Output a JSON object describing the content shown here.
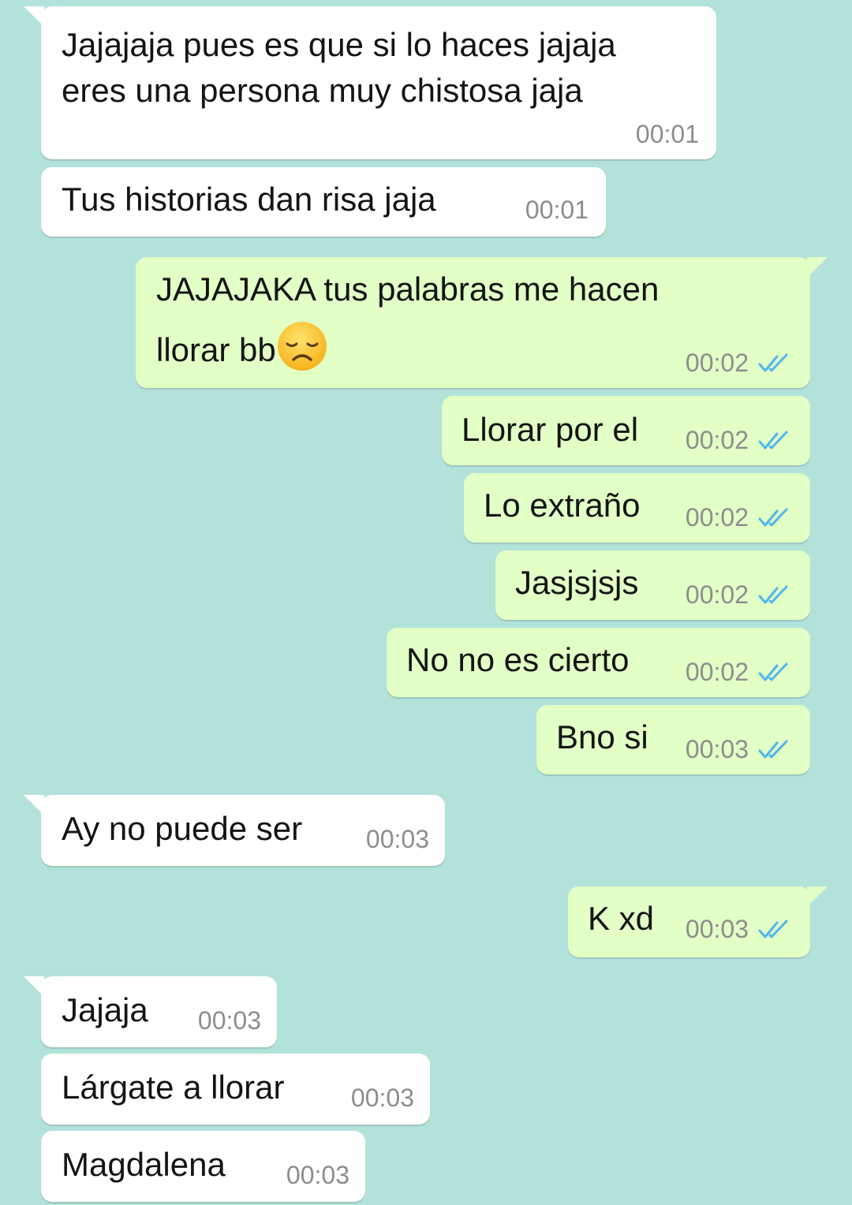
{
  "messages": [
    {
      "direction": "in",
      "lines": [
        "Jajajaja pues es que si lo haces jajaja",
        "eres una persona muy chistosa jaja"
      ],
      "time": "00:01"
    },
    {
      "direction": "in",
      "lines": [
        "Tus historias dan risa jaja"
      ],
      "time": "00:01"
    },
    {
      "direction": "out",
      "lines": [
        "JAJAJAKA tus palabras me hacen",
        "llorar bb"
      ],
      "emoji": "disappointed-face",
      "time": "00:02",
      "status": "read"
    },
    {
      "direction": "out",
      "lines": [
        "Llorar por el"
      ],
      "time": "00:02",
      "status": "read"
    },
    {
      "direction": "out",
      "lines": [
        "Lo extraño"
      ],
      "time": "00:02",
      "status": "read"
    },
    {
      "direction": "out",
      "lines": [
        "Jasjsjsjs"
      ],
      "time": "00:02",
      "status": "read"
    },
    {
      "direction": "out",
      "lines": [
        "No no es cierto"
      ],
      "time": "00:02",
      "status": "read"
    },
    {
      "direction": "out",
      "lines": [
        "Bno si"
      ],
      "time": "00:03",
      "status": "read"
    },
    {
      "direction": "in",
      "lines": [
        "Ay no puede ser"
      ],
      "time": "00:03"
    },
    {
      "direction": "out",
      "lines": [
        "K xd"
      ],
      "time": "00:03",
      "status": "read"
    },
    {
      "direction": "in",
      "lines": [
        "Jajaja"
      ],
      "time": "00:03"
    },
    {
      "direction": "in",
      "lines": [
        "Lárgate a llorar"
      ],
      "time": "00:03"
    },
    {
      "direction": "in",
      "lines": [
        "Magdalena"
      ],
      "time": "00:03"
    }
  ],
  "colors": {
    "background": "#b3e2db",
    "incoming_bubble": "#ffffff",
    "outgoing_bubble": "#e2ffc6",
    "read_ticks": "#4fb6ec",
    "timestamp": "#8d8d8d"
  }
}
